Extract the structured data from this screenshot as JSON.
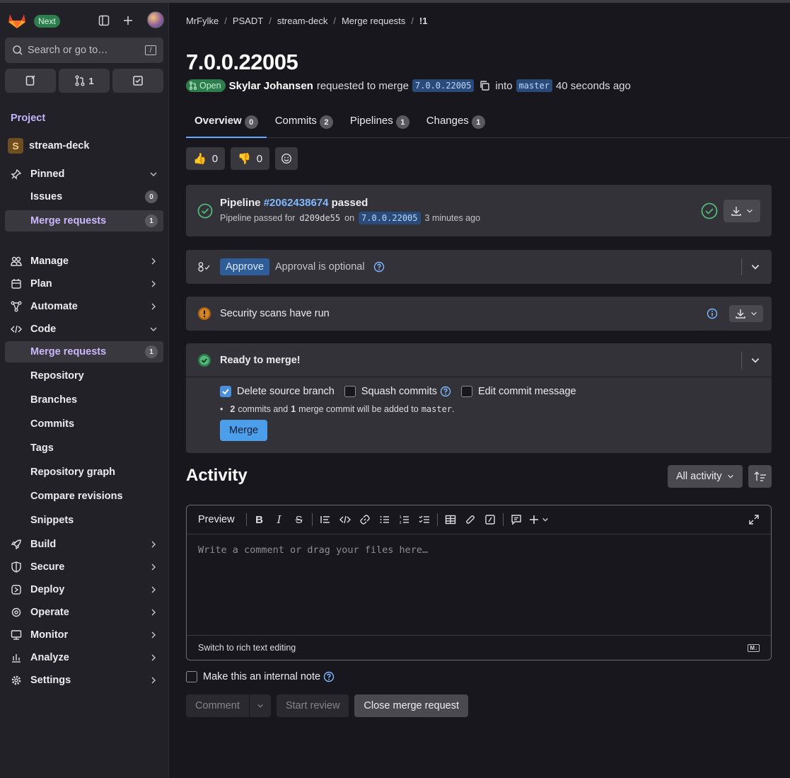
{
  "sidebar": {
    "next_badge": "Next",
    "search_placeholder": "Search or go to…",
    "search_shortcut": "/",
    "mr_count": "1",
    "section_label": "Project",
    "project_initial": "S",
    "project_name": "stream-deck",
    "pinned": {
      "label": "Pinned",
      "items": [
        {
          "label": "Issues",
          "count": "0"
        },
        {
          "label": "Merge requests",
          "count": "1"
        }
      ]
    },
    "nav": [
      {
        "label": "Manage"
      },
      {
        "label": "Plan"
      },
      {
        "label": "Automate"
      },
      {
        "label": "Code"
      }
    ],
    "code_items": [
      {
        "label": "Merge requests",
        "count": "1"
      },
      {
        "label": "Repository"
      },
      {
        "label": "Branches"
      },
      {
        "label": "Commits"
      },
      {
        "label": "Tags"
      },
      {
        "label": "Repository graph"
      },
      {
        "label": "Compare revisions"
      },
      {
        "label": "Snippets"
      }
    ],
    "nav2": [
      {
        "label": "Build"
      },
      {
        "label": "Secure"
      },
      {
        "label": "Deploy"
      },
      {
        "label": "Operate"
      },
      {
        "label": "Monitor"
      },
      {
        "label": "Analyze"
      },
      {
        "label": "Settings"
      }
    ]
  },
  "breadcrumb": [
    "MrFylke",
    "PSADT",
    "stream-deck",
    "Merge requests",
    "!1"
  ],
  "mr": {
    "title": "7.0.0.22005",
    "status": "Open",
    "author": "Skylar Johansen",
    "requested_text": "requested to merge",
    "source_branch": "7.0.0.22005",
    "into_text": "into",
    "target_branch": "master",
    "time_ago": "40 seconds ago"
  },
  "tabs": [
    {
      "label": "Overview",
      "count": "0"
    },
    {
      "label": "Commits",
      "count": "2"
    },
    {
      "label": "Pipelines",
      "count": "1"
    },
    {
      "label": "Changes",
      "count": "1"
    }
  ],
  "reactions": {
    "thumbs_up": "0",
    "thumbs_down": "0"
  },
  "pipeline": {
    "label": "Pipeline",
    "id": "#2062438674",
    "status": "passed",
    "sub_prefix": "Pipeline passed for",
    "commit": "d209de55",
    "on_text": "on",
    "branch": "7.0.0.22005",
    "time_ago": "3 minutes ago"
  },
  "approval": {
    "button": "Approve",
    "text": "Approval is optional"
  },
  "security": {
    "text": "Security scans have run"
  },
  "merge": {
    "title": "Ready to merge!",
    "delete_source": "Delete source branch",
    "squash": "Squash commits",
    "edit_message": "Edit commit message",
    "info_commits": "2",
    "info_text1": "commits and",
    "info_merge": "1",
    "info_text2": "merge commit will be added to",
    "info_target": "master",
    "info_end": ".",
    "button": "Merge"
  },
  "activity": {
    "title": "Activity",
    "filter": "All activity"
  },
  "editor": {
    "preview": "Preview",
    "placeholder": "Write a comment or drag your files here…",
    "switch_text": "Switch to rich text editing",
    "md_badge": "M↓"
  },
  "comment_form": {
    "internal_note": "Make this an internal note",
    "comment": "Comment",
    "start_review": "Start review",
    "close_mr": "Close merge request"
  },
  "colors": {
    "accent": "#c4b5fd",
    "link": "#7fb8ff",
    "success": "#2e7d4f",
    "merge": "#4b9ee9"
  }
}
